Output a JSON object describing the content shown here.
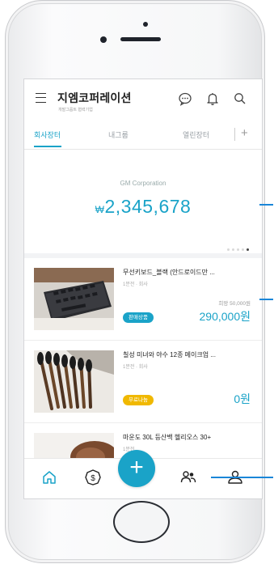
{
  "header": {
    "title": "지엠코퍼레이션",
    "subtitle": "개발그룹트 협력기업",
    "icons": [
      "chat-icon",
      "bell-icon",
      "search-icon"
    ]
  },
  "tabs": [
    {
      "label": "회사장터",
      "active": true
    },
    {
      "label": "내그룹",
      "active": false
    },
    {
      "label": "열린장터",
      "active": false
    }
  ],
  "tab_add_label": "+",
  "balance": {
    "company": "GM Corporation",
    "currency_symbol": "₩",
    "amount": "2,345,678",
    "page_count": 5,
    "active_page": 5
  },
  "items": [
    {
      "title": "무선키보드_블랙 (안드로이드만 ...",
      "meta": "1분전 · 회사",
      "original_price": "희망 50,000원",
      "badge": "판매상품",
      "price": "290,000원"
    },
    {
      "title": "칠성 미녀와 야수 12종 메이크업 ...",
      "meta": "1분전 · 회사",
      "original_price": "",
      "badge": "무료나눔",
      "price": "0원"
    },
    {
      "title": "마운도 30L 등산백 헬리오스 30+",
      "meta": "1분전",
      "original_price": "",
      "badge": "",
      "price": ""
    }
  ],
  "fab_label": "+",
  "bottom_nav": [
    "home-icon",
    "coin-icon",
    "add-icon",
    "group-icon",
    "profile-icon"
  ],
  "colors": {
    "accent": "#1aa3c8",
    "badge_free": "#f0b800",
    "annotation_line": "#1a86d8"
  }
}
